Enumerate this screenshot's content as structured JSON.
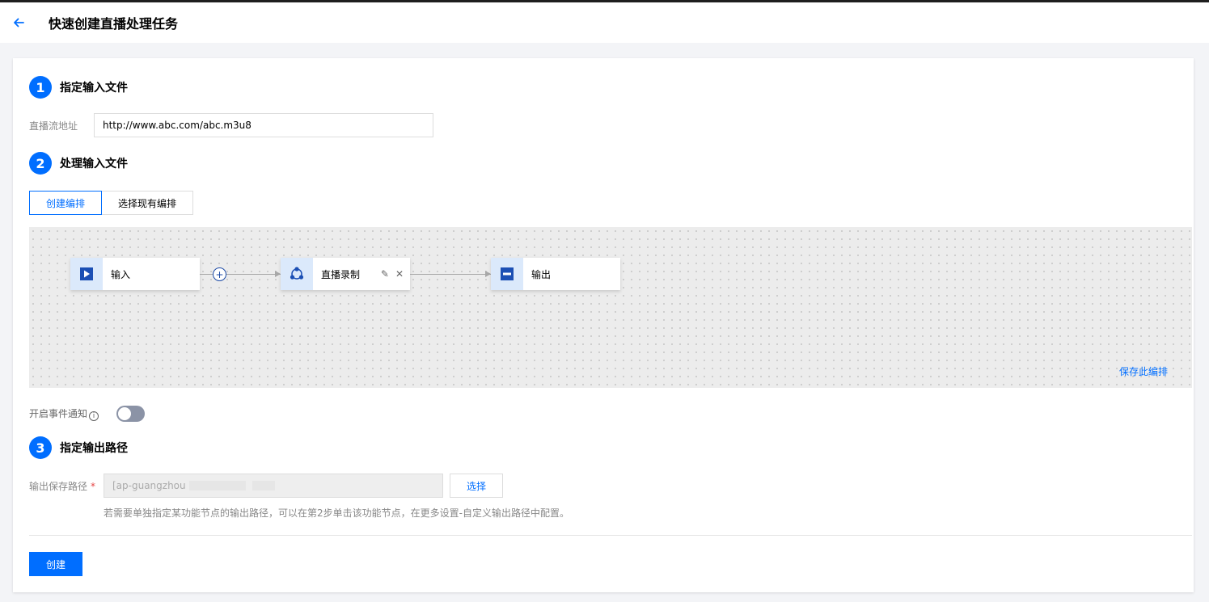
{
  "header": {
    "title": "快速创建直播处理任务"
  },
  "steps": [
    {
      "num": "1",
      "title": "指定输入文件"
    },
    {
      "num": "2",
      "title": "处理输入文件"
    },
    {
      "num": "3",
      "title": "指定输出路径"
    }
  ],
  "input": {
    "label": "直播流地址",
    "value": "http://www.abc.com/abc.m3u8"
  },
  "tabs": [
    {
      "label": "创建编排",
      "active": true
    },
    {
      "label": "选择现有编排",
      "active": false
    }
  ],
  "workflow": {
    "nodes": [
      {
        "label": "输入"
      },
      {
        "label": "直播录制"
      },
      {
        "label": "输出"
      }
    ],
    "plus": "+",
    "edit_icon": "✎",
    "close_icon": "✕",
    "save_link": "保存此编排"
  },
  "notification": {
    "label": "开启事件通知",
    "info": "i",
    "enabled": false
  },
  "output": {
    "label": "输出保存路径",
    "required": "*",
    "value": "[ap-guangzhou",
    "choose_button": "选择",
    "hint": "若需要单独指定某功能节点的输出路径，可以在第2步单击该功能节点，在更多设置-自定义输出路径中配置。"
  },
  "create_button": "创建",
  "colors": {
    "accent": "#006eff",
    "node_icon_bg": "#dbe9fb",
    "canvas_bg": "#ececec"
  }
}
